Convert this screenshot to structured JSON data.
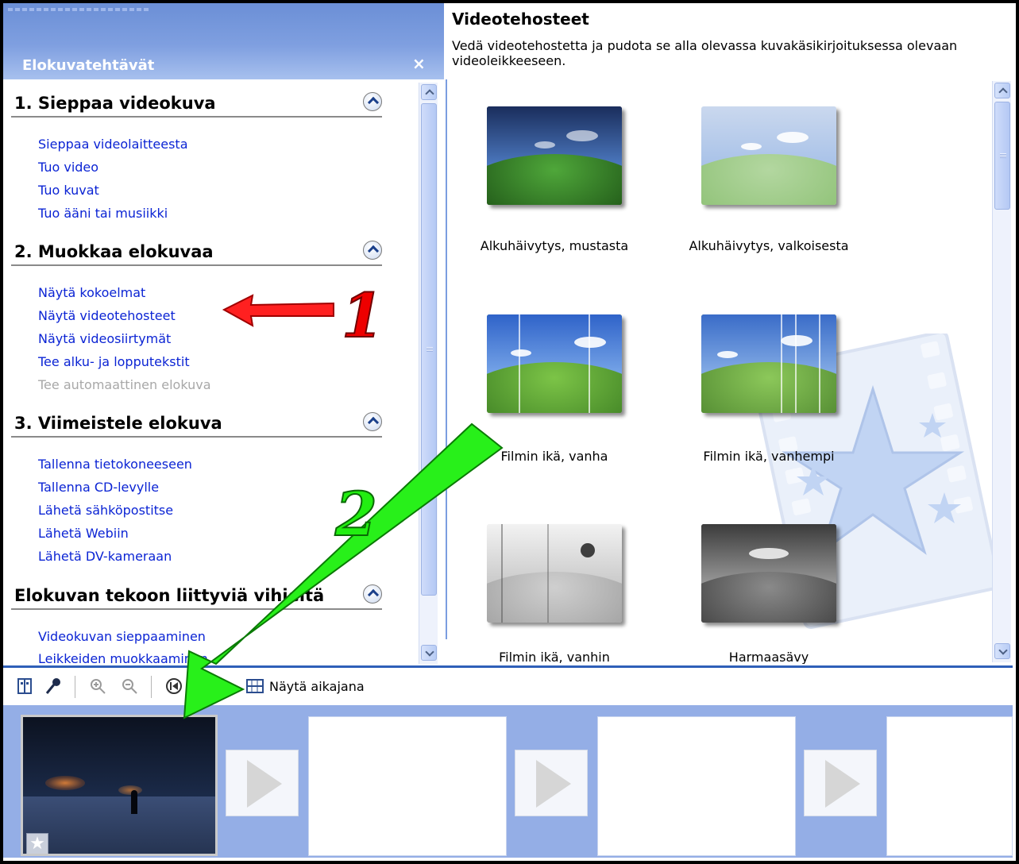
{
  "task_pane": {
    "title": "Elokuvatehtävät",
    "close_glyph": "×",
    "sections": [
      {
        "title": "1. Sieppaa videokuva",
        "links": [
          "Sieppaa videolaitteesta",
          "Tuo video",
          "Tuo kuvat",
          "Tuo ääni tai musiikki"
        ]
      },
      {
        "title": "2. Muokkaa elokuvaa",
        "links": [
          "Näytä kokoelmat",
          "Näytä videotehosteet",
          "Näytä videosiirtymät",
          "Tee alku- ja lopputekstit"
        ],
        "disabled_link": "Tee automaattinen elokuva"
      },
      {
        "title": "3. Viimeistele elokuva",
        "links": [
          "Tallenna tietokoneeseen",
          "Tallenna CD-levylle",
          "Lähetä sähköpostitse",
          "Lähetä Webiin",
          "Lähetä DV-kameraan"
        ]
      },
      {
        "title": "Elokuvan tekoon liittyviä vihjeitä",
        "links": [
          "Videokuvan sieppaaminen",
          "Leikkeiden muokkaaminen"
        ]
      }
    ]
  },
  "effects": {
    "title": "Videotehosteet",
    "description": "Vedä videotehostetta ja pudota se alla olevassa kuvakäsikirjoituksessa olevaan videoleikkeeseen.",
    "items": [
      {
        "label": "Alkuhäivytys, mustasta",
        "style": "dark"
      },
      {
        "label": "Alkuhäivytys, valkoisesta",
        "style": "light"
      },
      {
        "label": "Filmin ikä, vanha",
        "style": "old"
      },
      {
        "label": "Filmin ikä, vanhempi",
        "style": "older"
      },
      {
        "label": "Filmin ikä, vanhin",
        "style": "oldest"
      },
      {
        "label": "Harmaasävy",
        "style": "gray"
      }
    ]
  },
  "toolbar": {
    "timeline_label": "Näytä aikajana",
    "icons": [
      "storyboard-icon",
      "narrate-icon",
      "zoom-in-icon",
      "zoom-out-icon",
      "rewind-icon",
      "play-icon",
      "timeline-icon"
    ]
  },
  "annotations": {
    "label_1": "1",
    "label_2": "2",
    "color_1": "#e00000",
    "color_2": "#22ee11"
  },
  "colors": {
    "header_blue": "#6b8fd6",
    "link_blue": "#0b24d4",
    "storyboard_bg": "#94aee6"
  }
}
